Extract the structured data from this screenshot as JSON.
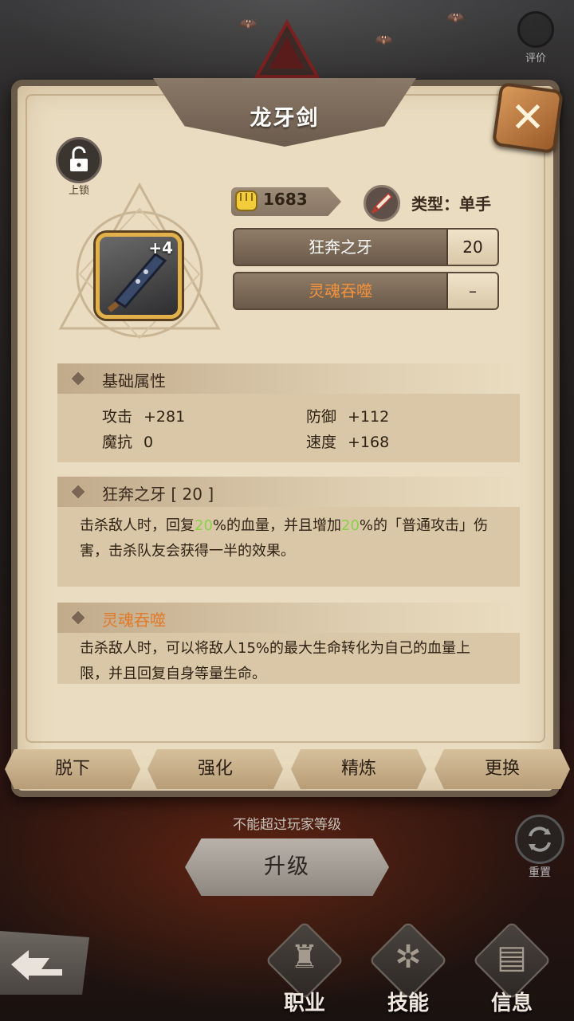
{
  "top": {
    "rate_label": "评价"
  },
  "panel": {
    "title": "龙牙剑",
    "close_label": "✕",
    "lock_label": "上锁",
    "item": {
      "enhance_level": "+4"
    },
    "gold": {
      "value": "1683"
    },
    "type": {
      "text": "类型：单手"
    },
    "skills": [
      {
        "name": "狂奔之牙",
        "level": "20",
        "color": "#ffffff"
      },
      {
        "name": "灵魂吞噬",
        "level": "–",
        "color": "#f5923a"
      }
    ],
    "base_stats": {
      "title": "基础属性",
      "stats": [
        {
          "label": "攻击",
          "value": "+281"
        },
        {
          "label": "防御",
          "value": "+112"
        },
        {
          "label": "魔抗",
          "value": "0"
        },
        {
          "label": "速度",
          "value": "+168"
        }
      ]
    },
    "skill1": {
      "title": "狂奔之牙 [ 20 ]",
      "desc_a": "击杀敌人时，回复",
      "pct_a": "20",
      "desc_b": "%的血量，并且增加",
      "pct_b": "20",
      "desc_c": "%的「普通攻击」伤害，击杀队友会获得一半的效果。"
    },
    "skill2": {
      "title": "灵魂吞噬",
      "desc": "击杀敌人时，可以将敌人15%的最大生命转化为自己的血量上限，并且回复自身等量生命。"
    },
    "actions": [
      "脱下",
      "强化",
      "精炼",
      "更换"
    ]
  },
  "upgrade": {
    "note": "不能超过玩家等级",
    "label": "升级",
    "reset_label": "重置"
  },
  "bottom_nav": [
    {
      "label": "职业",
      "icon": "chess-piece-icon"
    },
    {
      "label": "技能",
      "icon": "skill-rune-icon"
    },
    {
      "label": "信息",
      "icon": "document-icon"
    }
  ],
  "colors": {
    "highlight": "#8ad14a",
    "orange": "#f5923a",
    "gold_frame": "#e2b14a"
  }
}
